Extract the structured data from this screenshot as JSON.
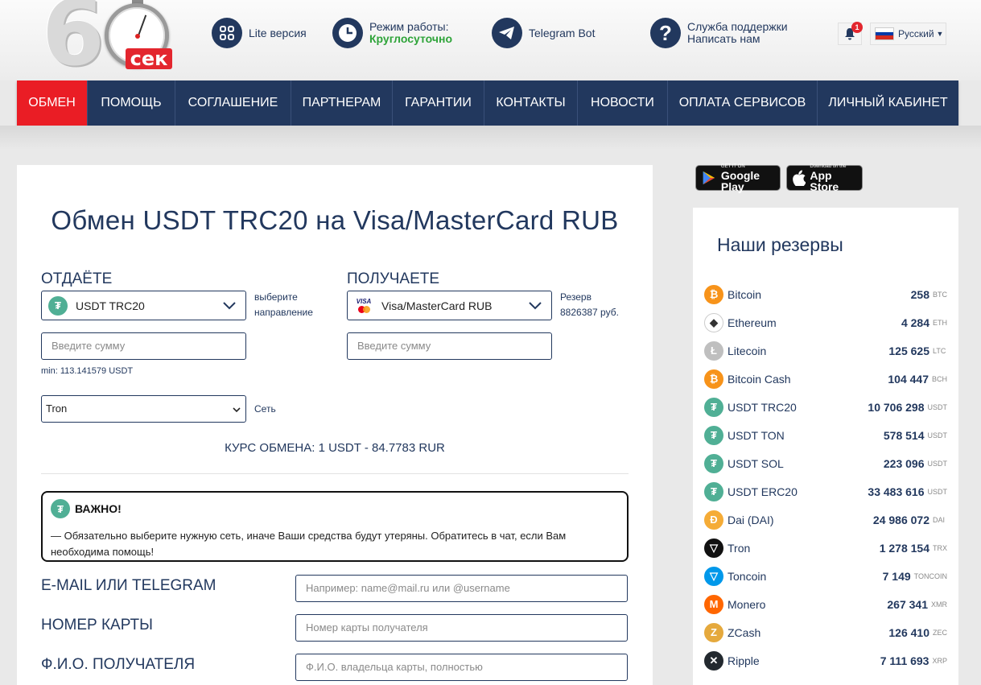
{
  "header": {
    "logo_text": "сек",
    "lite": "Lite версия",
    "hours_label": "Режим работы:",
    "hours_value": "Круглосуточно",
    "telegram": "Telegram Bot",
    "support_line1": "Служба поддержки",
    "support_line2": "Написать нам",
    "notifications_count": "1",
    "language": "Русский"
  },
  "nav": {
    "items": [
      {
        "label": "ОБМЕН"
      },
      {
        "label": "ПОМОЩЬ"
      },
      {
        "label": "СОГЛАШЕНИЕ"
      },
      {
        "label": "ПАРТНЕРАМ"
      },
      {
        "label": "ГАРАНТИИ"
      },
      {
        "label": "КОНТАКТЫ"
      },
      {
        "label": "НОВОСТИ"
      },
      {
        "label": "ОПЛАТА СЕРВИСОВ"
      },
      {
        "label": "ЛИЧНЫЙ КАБИНЕТ"
      }
    ]
  },
  "exchange": {
    "title": "Обмен USDT TRC20 на Visa/MasterCard RUB",
    "give_label": "ОТДАЁТЕ",
    "give_currency": "USDT TRC20",
    "give_hint_1": "выберите",
    "give_hint_2": "направление",
    "receive_label": "ПОЛУЧАЕТЕ",
    "receive_currency": "Visa/MasterCard RUB",
    "reserve_label": "Резерв",
    "reserve_value": "8826387 руб.",
    "amount_placeholder": "Введите сумму",
    "min_note": "min: 113.141579 USDT",
    "network_value": "Tron",
    "network_label": "Сеть",
    "rate": "КУРС ОБМЕНА: 1 USDT - 84.7783 RUR",
    "important_title": "ВАЖНО!",
    "important_text": "— Обязательно выберите нужную сеть, иначе Ваши средства будут утеряны. Обратитесь в чат, если Вам необходима помощь!",
    "email_label": "E-MAIL ИЛИ TELEGRAM",
    "email_placeholder": "Например: name@mail.ru или @username",
    "card_label": "НОМЕР КАРТЫ",
    "card_placeholder": "Номер карты получателя",
    "name_label": "Ф.И.О. ПОЛУЧАТЕЛЯ",
    "name_placeholder": "Ф.И.О. владельца карты, полностью"
  },
  "stores": {
    "google_small": "GET IT ON",
    "google_big": "Google Play",
    "apple_small": "Download on the",
    "apple_big": "App Store"
  },
  "reserves": {
    "title": "Наши резервы",
    "items": [
      {
        "name": "Bitcoin",
        "amount": "258",
        "code": "BTC",
        "icon": "bitcoin-icon",
        "color": "#f7931a",
        "glyph": "₿"
      },
      {
        "name": "Ethereum",
        "amount": "4 284",
        "code": "ETH",
        "icon": "ethereum-icon",
        "color": "#ffffff",
        "glyph": "◆"
      },
      {
        "name": "Litecoin",
        "amount": "125 625",
        "code": "LTC",
        "icon": "litecoin-icon",
        "color": "#bfbfbf",
        "glyph": "Ł"
      },
      {
        "name": "Bitcoin Cash",
        "amount": "104 447",
        "code": "BCH",
        "icon": "bitcoin-cash-icon",
        "color": "#f7931a",
        "glyph": "₿"
      },
      {
        "name": "USDT TRC20",
        "amount": "10 706 298",
        "code": "USDT",
        "icon": "tether-icon",
        "color": "#50af95",
        "glyph": "₮"
      },
      {
        "name": "USDT TON",
        "amount": "578 514",
        "code": "USDT",
        "icon": "tether-icon",
        "color": "#50af95",
        "glyph": "₮"
      },
      {
        "name": "USDT SOL",
        "amount": "223 096",
        "code": "USDT",
        "icon": "tether-icon",
        "color": "#50af95",
        "glyph": "₮"
      },
      {
        "name": "USDT ERC20",
        "amount": "33 483 616",
        "code": "USDT",
        "icon": "tether-icon",
        "color": "#50af95",
        "glyph": "₮"
      },
      {
        "name": "Dai (DAI)",
        "amount": "24 986 072",
        "code": "DAI",
        "icon": "dai-icon",
        "color": "#f5ac37",
        "glyph": "Đ"
      },
      {
        "name": "Tron",
        "amount": "1 278 154",
        "code": "TRX",
        "icon": "tron-icon",
        "color": "#111111",
        "glyph": "▽"
      },
      {
        "name": "Toncoin",
        "amount": "7 149",
        "code": "TONCOIN",
        "icon": "toncoin-icon",
        "color": "#0098ea",
        "glyph": "▽"
      },
      {
        "name": "Monero",
        "amount": "267 341",
        "code": "XMR",
        "icon": "monero-icon",
        "color": "#ff6600",
        "glyph": "M"
      },
      {
        "name": "ZCash",
        "amount": "126 410",
        "code": "ZEC",
        "icon": "zcash-icon",
        "color": "#e5a93d",
        "glyph": "Z"
      },
      {
        "name": "Ripple",
        "amount": "7 111 693",
        "code": "XRP",
        "icon": "ripple-icon",
        "color": "#23292f",
        "glyph": "✕"
      }
    ]
  },
  "colors": {
    "navy": "#22385e",
    "red": "#ea1d25",
    "green": "#2fa43a",
    "tether": "#50af95"
  }
}
